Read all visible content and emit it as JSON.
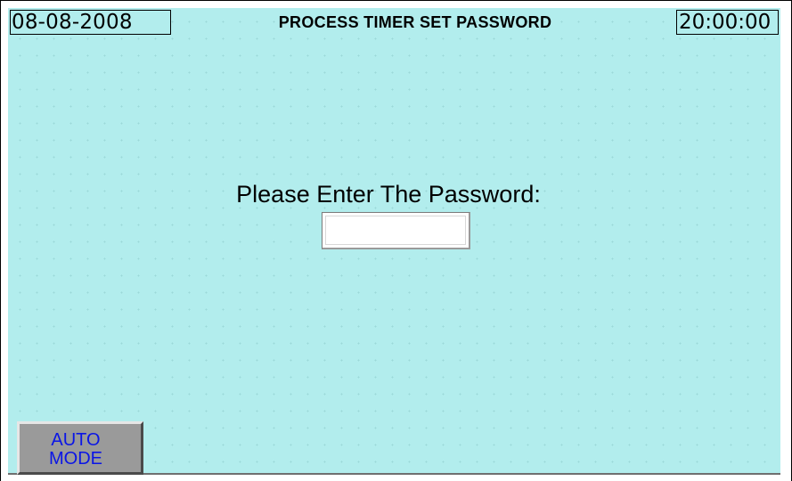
{
  "header": {
    "date": "08-08-2008",
    "title": "PROCESS TIMER SET PASSWORD",
    "time": "20:00:00"
  },
  "main": {
    "prompt": "Please Enter The Password:",
    "password_value": ""
  },
  "footer": {
    "auto_mode_button": {
      "line1": "AUTO",
      "line2": "MODE"
    }
  },
  "colors": {
    "screen_background": "#b2eded",
    "button_face": "#9a9a9a",
    "button_text": "#0a15e6"
  }
}
